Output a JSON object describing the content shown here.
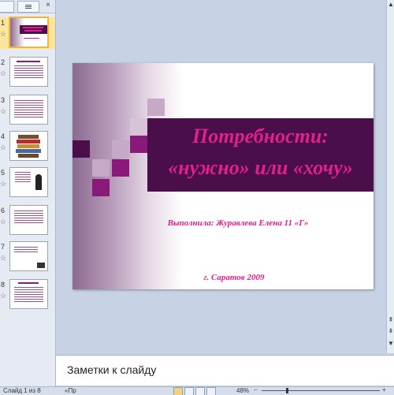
{
  "left_pane": {
    "tabs": {
      "slides": "",
      "outline": ""
    },
    "thumbnails": [
      {
        "number": "1",
        "selected": true
      },
      {
        "number": "2",
        "selected": false
      },
      {
        "number": "3",
        "selected": false
      },
      {
        "number": "4",
        "selected": false
      },
      {
        "number": "5",
        "selected": false
      },
      {
        "number": "6",
        "selected": false
      },
      {
        "number": "7",
        "selected": false
      },
      {
        "number": "8",
        "selected": false
      }
    ]
  },
  "slide": {
    "title_line1": "Потребности:",
    "title_line2": "«нужно» или «хочу»",
    "author": "Выполнила: Журавлева Елена 11 «Г»",
    "city": "г. Саратов 2009",
    "colors": {
      "band": "#4a0e4a",
      "text": "#e0208f",
      "square_dark": "#8a1a7a",
      "square_light": "#c5a9c7"
    }
  },
  "notes": {
    "placeholder": "Заметки к слайду"
  },
  "status": {
    "slide_info": "Слайд 1 из 8",
    "theme": "«Пр",
    "zoom": "48%"
  }
}
